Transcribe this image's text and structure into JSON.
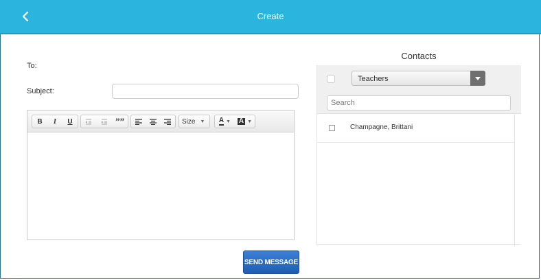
{
  "header": {
    "title": "Create",
    "back_icon": "chevron-left-icon"
  },
  "form": {
    "to_label": "To:",
    "subject_label": "Subject:",
    "subject_value": ""
  },
  "toolbar": {
    "bold": "B",
    "italic": "I",
    "underline": "U",
    "quote": "””",
    "size_label": "Size",
    "font_color": "A",
    "highlight_color": "A"
  },
  "contacts": {
    "title": "Contacts",
    "group_selected": "Teachers",
    "search_placeholder": "Search",
    "items": [
      {
        "name": "Champagne, Brittani",
        "checked": false
      }
    ]
  },
  "actions": {
    "send_label": "SEND MESSAGE"
  },
  "colors": {
    "header": "#2bb5de",
    "send_button": "#2a6cc4"
  }
}
